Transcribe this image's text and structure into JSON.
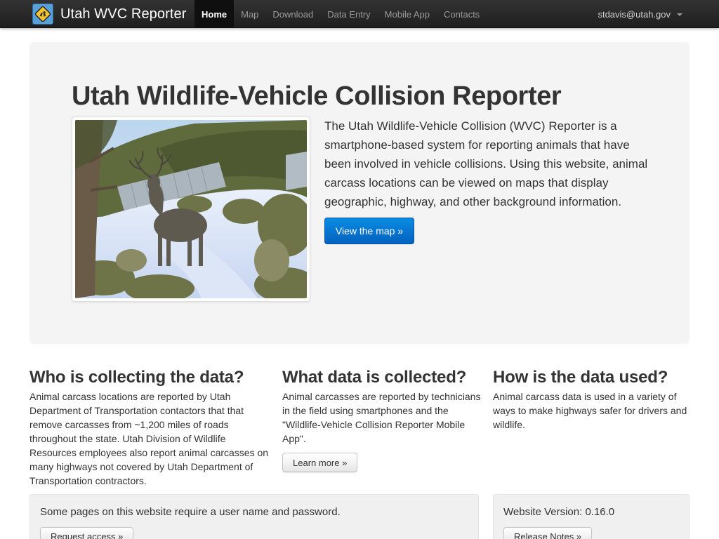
{
  "nav": {
    "brand": "Utah WVC Reporter",
    "brand_icon": "deer-crossing-sign-icon",
    "items": [
      {
        "label": "Home",
        "active": true
      },
      {
        "label": "Map"
      },
      {
        "label": "Download"
      },
      {
        "label": "Data Entry"
      },
      {
        "label": "Mobile App"
      },
      {
        "label": "Contacts"
      }
    ],
    "user": "stdavis@utah.gov"
  },
  "hero": {
    "title": "Utah Wildlife-Vehicle Collision Reporter",
    "description": "The Utah Wildlife-Vehicle Collision (WVC) Reporter is a smartphone-based system for reporting animals that have been involved in vehicle collisions. Using this website, animal carcass locations can be viewed on maps that display geographic, highway, and other background information.",
    "button": "View the map »"
  },
  "columns": [
    {
      "heading": "Who is collecting the data?",
      "body": "Animal carcass locations are reported by Utah Department of Transportation contactors that that remove carcasses from ~1,200 miles of roads throughout the state. Utah Division of Wildlife Resources employees also report animal carcasses on many highways not covered by Utah Department of Transportation contractors."
    },
    {
      "heading": "What data is collected?",
      "body": "Animal carcasses are reported by technicians in the field using smartphones and the \"Wildlife-Vehicle Collision Reporter Mobile App\".",
      "button": "Learn more »"
    },
    {
      "heading": "How is the data used?",
      "body": "Animal carcass data is used in a variety of ways to make highways safer for drivers and wildlife."
    }
  ],
  "wells": {
    "login": {
      "text": "Some pages on this website require a user name and password.",
      "button": "Request access »"
    },
    "version": {
      "text": "Website Version: 0.16.0",
      "button": "Release Notes »"
    }
  },
  "colors": {
    "navbar": "#222222",
    "primary_button": "#0074cc",
    "hero_background": "#f4f4f4"
  }
}
